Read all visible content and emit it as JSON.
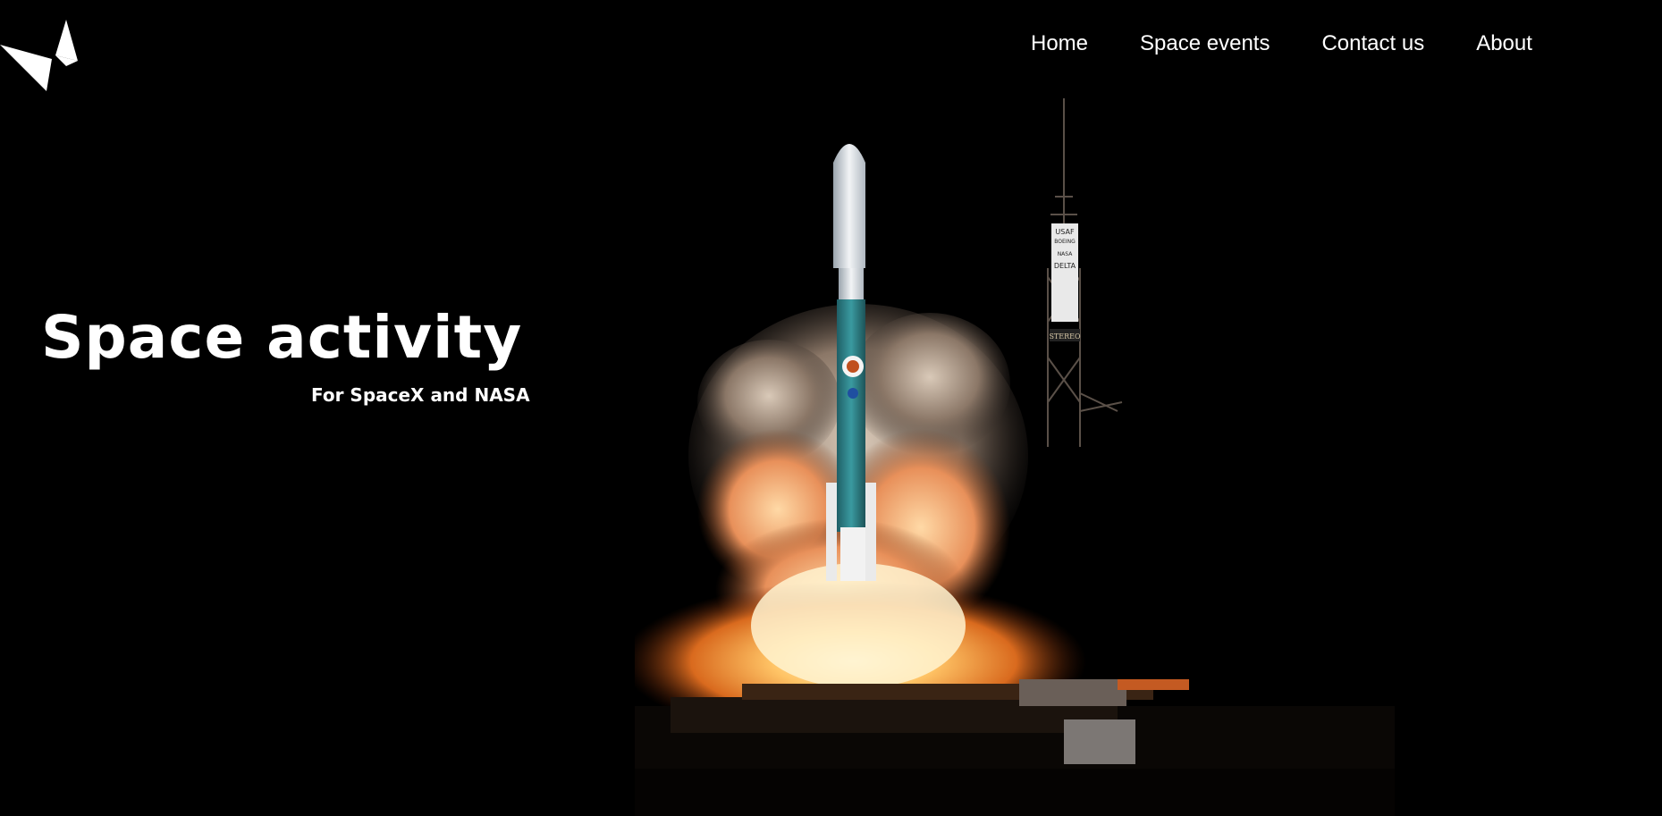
{
  "nav": {
    "items": [
      {
        "label": "Home"
      },
      {
        "label": "Space events"
      },
      {
        "label": "Contact us"
      },
      {
        "label": "About"
      }
    ]
  },
  "hero": {
    "title": "Space activity",
    "subtitle": "For SpaceX and NASA"
  },
  "launch_image": {
    "tower_sign": [
      "USAF",
      "BOEING",
      "NASA",
      "DELTA",
      "STEREO"
    ]
  },
  "colors": {
    "background": "#000000",
    "text": "#ffffff",
    "rocket_teal": "#2a7f86",
    "flame": "#ffb55a"
  }
}
